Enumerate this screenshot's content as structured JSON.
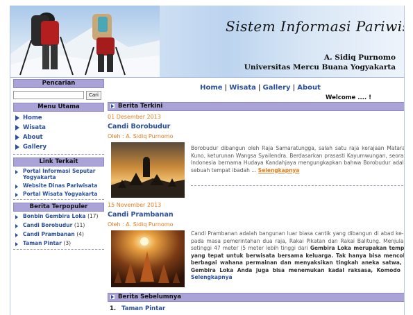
{
  "header": {
    "site_title": "Sistem Informasi Pariwisata",
    "author": "A. Sidiq Purnomo",
    "university": "Universitas Mercu Buana Yogyakarta"
  },
  "sidebar": {
    "search": {
      "heading": "Pencarian",
      "input_value": "",
      "button_label": "Cari"
    },
    "main_menu": {
      "heading": "Menu Utama",
      "items": [
        "Home",
        "Wisata",
        "About",
        "Gallery"
      ]
    },
    "related_links": {
      "heading": "Link Terkait",
      "items": [
        "Portal Informasi Seputar Yogyakarta",
        "Website Dinas Pariwisata",
        "Portal Wisata Yogyakarta"
      ]
    },
    "popular": {
      "heading": "Berita Terpopuler",
      "items": [
        {
          "label": "Bonbin Gembira Loka",
          "count": "(17)"
        },
        {
          "label": "Candi Borobudur",
          "count": "(11)"
        },
        {
          "label": "Candi Prambanan",
          "count": "(4)"
        },
        {
          "label": "Taman Pintar",
          "count": "(3)"
        }
      ]
    }
  },
  "topnav": {
    "items": [
      "Home",
      "Wisata",
      "Gallery",
      "About"
    ],
    "separator": "|"
  },
  "welcome": "Welcome .... !",
  "latest": {
    "heading": "Berita Terkini",
    "articles": [
      {
        "date": "01 Desember 2013",
        "title": "Candi Borobudur",
        "byline": "Oleh : A. Sidiq Purnomo",
        "text": "Borobudur dibangun oleh Raja Samaratungga, salah satu raja kerajaan Mataram Kuno, keturunan Wangsa Syailendra. Berdasarkan prasasti Kayumwungan, seorang Indonesia bernama Hudaya Kandahjaya mengungkapkan bahwa Borobudur adalah sebuah tempat ibadah ...",
        "more_label": "Selengkapnya"
      },
      {
        "date": "15 November 2013",
        "title": "Candi Prambanan",
        "byline": "Oleh : A. Sidiq Purnomo",
        "text_a": "Candi Prambanan adalah bangunan luar biasa cantik yang dibangun di abad ke-10 pada masa pemerintahan dua raja, Rakai Pikatan dan Rakai Balitung. Menjulang setinggi 47 meter (5 meter lebih tinggi dari",
        "text_b": "Gembira Loka merupakan tempat yang tepat untuk berwisata bersama keluarga. Tak hanya bisa mencoba berbagai wahana permainan dan menyaksikan tingkah aneka satwa, di Gembira Loka Anda juga bisa menemukan kadal raksasa, Komodo ...",
        "more_label": "Selengkapnya"
      }
    ]
  },
  "previous": {
    "heading": "Berita Sebelumnya",
    "items": [
      {
        "num": "1.",
        "label": "Taman Pintar"
      }
    ]
  },
  "colors": {
    "link_blue": "#2a4f9c",
    "accent_orange": "#e07b1f",
    "section_header_bg": "#a9a3d8"
  }
}
